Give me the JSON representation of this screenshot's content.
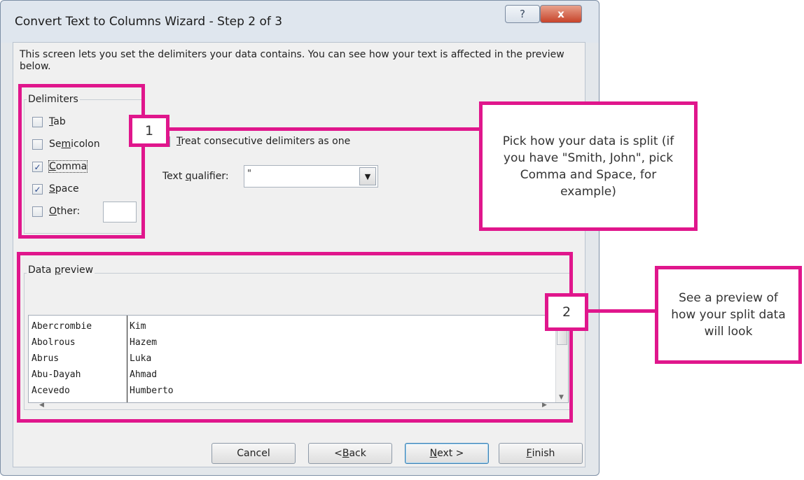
{
  "window": {
    "title": "Convert Text to Columns Wizard - Step 2 of 3",
    "help_glyph": "?",
    "close_glyph": "x"
  },
  "intro_text": "This screen lets you set the delimiters your data contains.  You can see how your text is affected in the preview below.",
  "delimiters": {
    "group_label": "Delimiters",
    "items": [
      {
        "label_pre": "",
        "mnemonic": "T",
        "label_post": "ab",
        "checked": false
      },
      {
        "label_pre": "Se",
        "mnemonic": "m",
        "label_post": "icolon",
        "checked": false
      },
      {
        "label_pre": "",
        "mnemonic": "C",
        "label_post": "omma",
        "checked": true
      },
      {
        "label_pre": "",
        "mnemonic": "S",
        "label_post": "pace",
        "checked": true
      },
      {
        "label_pre": "",
        "mnemonic": "O",
        "label_post": "ther:",
        "checked": false
      }
    ],
    "other_value": ""
  },
  "consecutive": {
    "mnemonic": "T",
    "label_post": "reat consecutive delimiters as one",
    "checked": false
  },
  "text_qualifier": {
    "label_pre": "Text ",
    "mnemonic": "q",
    "label_post": "ualifier:",
    "value": "\""
  },
  "preview": {
    "group_label_pre": "Data ",
    "mnemonic": "p",
    "group_label_post": "review",
    "rows": [
      [
        "Abercrombie",
        "Kim"
      ],
      [
        "Abolrous",
        "Hazem"
      ],
      [
        "Abrus",
        "Luka"
      ],
      [
        "Abu-Dayah",
        "Ahmad"
      ],
      [
        "Acevedo",
        "Humberto"
      ]
    ]
  },
  "buttons": {
    "cancel": "Cancel",
    "back_pre": "< ",
    "back_mnemonic": "B",
    "back_post": "ack",
    "next_mnemonic": "N",
    "next_post": "ext >",
    "finish_mnemonic": "F",
    "finish_post": "inish"
  },
  "callouts": [
    {
      "number": "1",
      "text": "Pick how your data is split (if you have \"Smith, John\", pick Comma and Space, for example)"
    },
    {
      "number": "2",
      "text": "See a preview of how your split data will look"
    }
  ],
  "colors": {
    "highlight": "#e0168c",
    "check_mark": "#2a4a8c"
  }
}
